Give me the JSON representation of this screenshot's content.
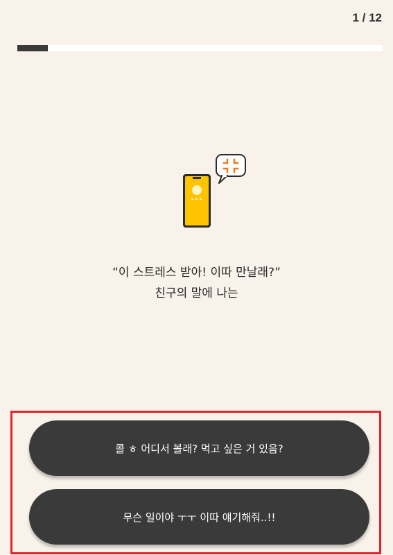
{
  "progress": {
    "counter": "1 / 12",
    "fraction": 0.0833
  },
  "illustration": {
    "phone_icon": "phone-icon",
    "bubble_icon": "angry-speech-bubble-icon",
    "phone_color": "#ffc400",
    "anger_color": "#f07a1a"
  },
  "question": {
    "line1": "“이 스트레스 받아! 이따 만날래?”",
    "line2": "친구의 말에 나는"
  },
  "answers": [
    {
      "label": "콜 ㅎ 어디서 볼래? 먹고 싶은 거 있음?"
    },
    {
      "label": "무슨 일이야 ㅜㅜ 이따 얘기해줘..!!"
    }
  ],
  "colors": {
    "background": "#f8f2ea",
    "button": "#3a3a3a",
    "highlight_border": "#e3232d"
  }
}
